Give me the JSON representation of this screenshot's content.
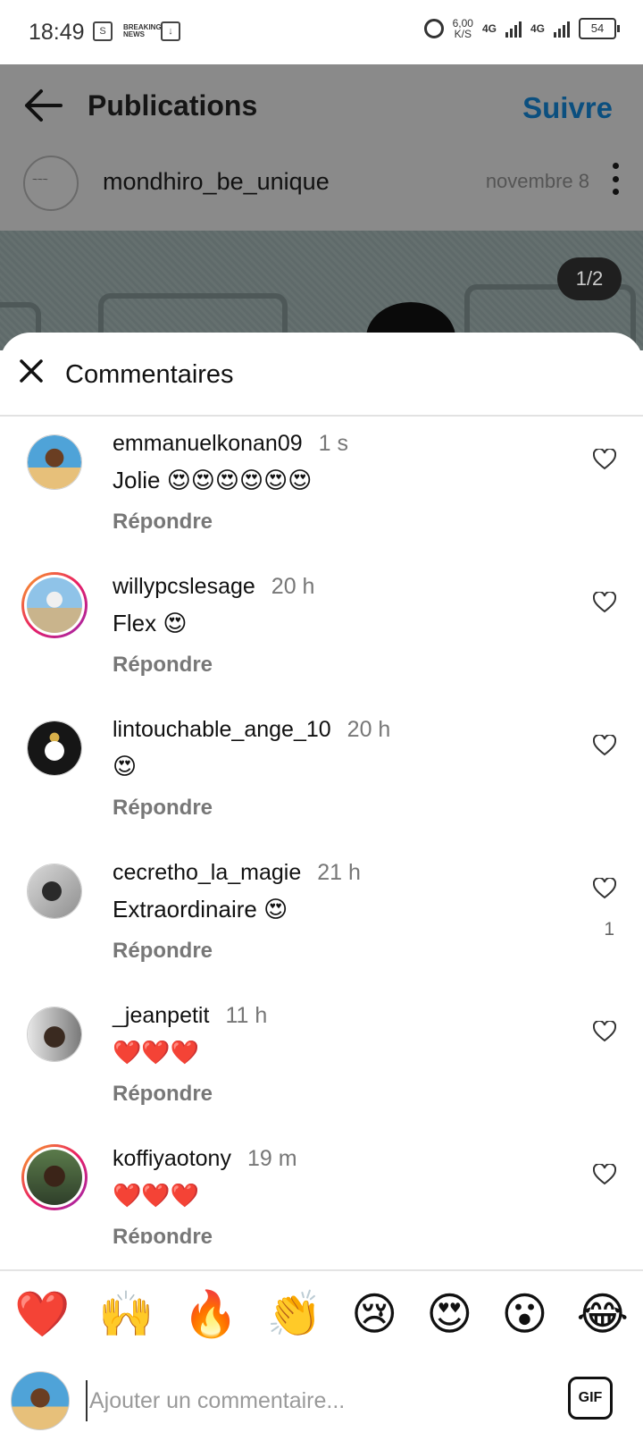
{
  "status_bar": {
    "time": "18:49",
    "news_label": "BREAKING NEWS",
    "speed_value": "6,00",
    "speed_unit": "K/S",
    "network_1": "4G",
    "network_2": "4G",
    "battery": "54"
  },
  "header": {
    "title": "Publications",
    "follow_label": "Suivre"
  },
  "post": {
    "author": "mondhiro_be_unique",
    "date": "novembre 8",
    "slide_indicator": "1/2"
  },
  "comments_sheet": {
    "title": "Commentaires",
    "comments": [
      {
        "username": "emmanuelkonan09",
        "time": "1 s",
        "text": "Jolie 😍😍😍😍😍😍",
        "reply": "Répondre",
        "likes": ""
      },
      {
        "username": "willypcslesage",
        "time": "20 h",
        "text": "Flex 😍",
        "reply": "Répondre",
        "likes": ""
      },
      {
        "username": "lintouchable_ange_10",
        "time": "20 h",
        "text": "😍",
        "reply": "Répondre",
        "likes": ""
      },
      {
        "username": "cecretho_la_magie",
        "time": "21 h",
        "text": "Extraordinaire 😍",
        "reply": "Répondre",
        "likes": "1"
      },
      {
        "username": "_jeanpetit",
        "time": "11 h",
        "text": "❤️❤️❤️",
        "reply": "Répondre",
        "likes": ""
      },
      {
        "username": "koffiyaotony",
        "time": "19 m",
        "text": "❤️❤️❤️",
        "reply": "Répondre",
        "likes": ""
      }
    ]
  },
  "quick_emojis": [
    "❤️",
    "🙌",
    "🔥",
    "👏",
    "😢",
    "😍",
    "😮",
    "😂"
  ],
  "composer": {
    "placeholder": "Ajouter un commentaire...",
    "gif_label": "GIF"
  },
  "colors": {
    "accent": "#0b4f7f",
    "dim_overlay": "#8a8a8a",
    "muted_text": "#777777"
  }
}
